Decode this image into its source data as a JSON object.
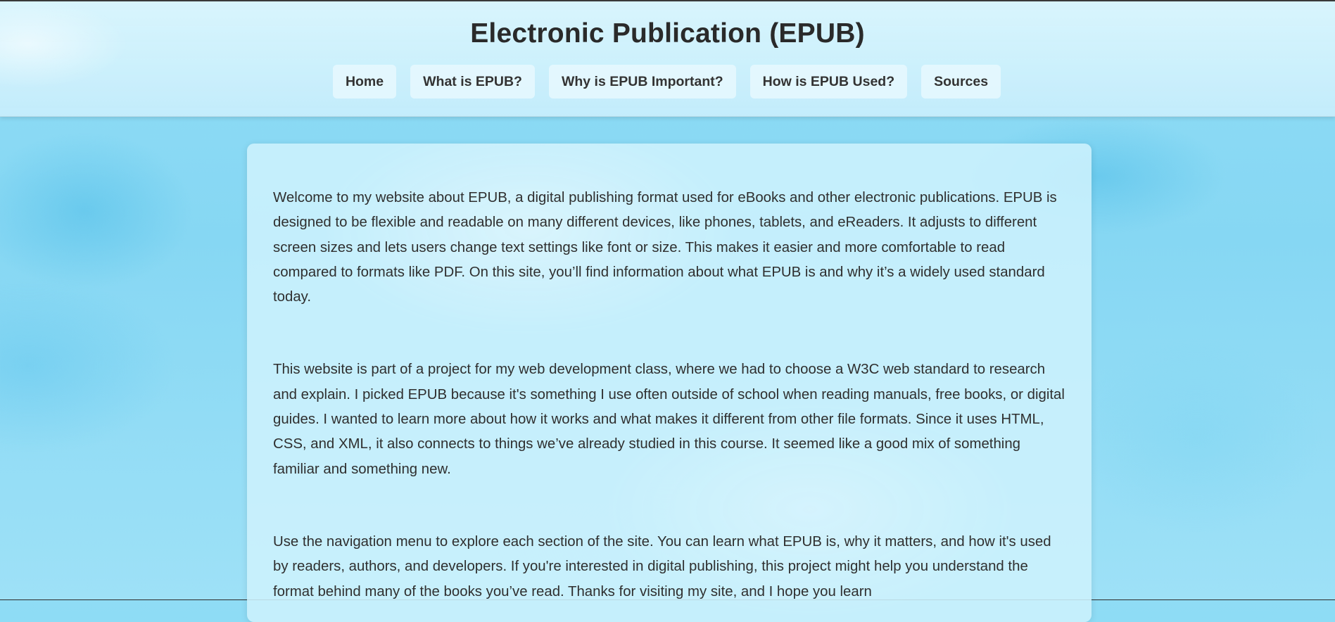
{
  "header": {
    "title": "Electronic Publication (EPUB)",
    "nav": [
      {
        "label": "Home"
      },
      {
        "label": "What is EPUB?"
      },
      {
        "label": "Why is EPUB Important?"
      },
      {
        "label": "How is EPUB Used?"
      },
      {
        "label": "Sources"
      }
    ]
  },
  "main": {
    "paragraphs": [
      "Welcome to my website about EPUB, a digital publishing format used for eBooks and other electronic publications. EPUB is designed to be flexible and readable on many different devices, like phones, tablets, and eReaders. It adjusts to different screen sizes and lets users change text settings like font or size. This makes it easier and more comfortable to read compared to formats like PDF. On this site, you’ll find information about what EPUB is and why it’s a widely used standard today.",
      "This website is part of a project for my web development class, where we had to choose a W3C web standard to research and explain. I picked EPUB because it's something I use often outside of school when reading manuals, free books, or digital guides. I wanted to learn more about how it works and what makes it different from other file formats. Since it uses HTML, CSS, and XML, it also connects to things we’ve already studied in this course. It seemed like a good mix of something familiar and something new.",
      "Use the navigation menu to explore each section of the site. You can learn what EPUB is, why it matters, and how it's used by readers, authors, and developers. If you're interested in digital publishing, this project might help you understand the format behind many of the books you’ve read. Thanks for visiting my site, and I hope you learn"
    ]
  },
  "colors": {
    "background": "#8fdcf5",
    "header_bg": "#d6f3fd",
    "card_bg": "#cdf1fd",
    "text": "#2f2f2f",
    "nav_button_bg": "#ebfaff"
  }
}
